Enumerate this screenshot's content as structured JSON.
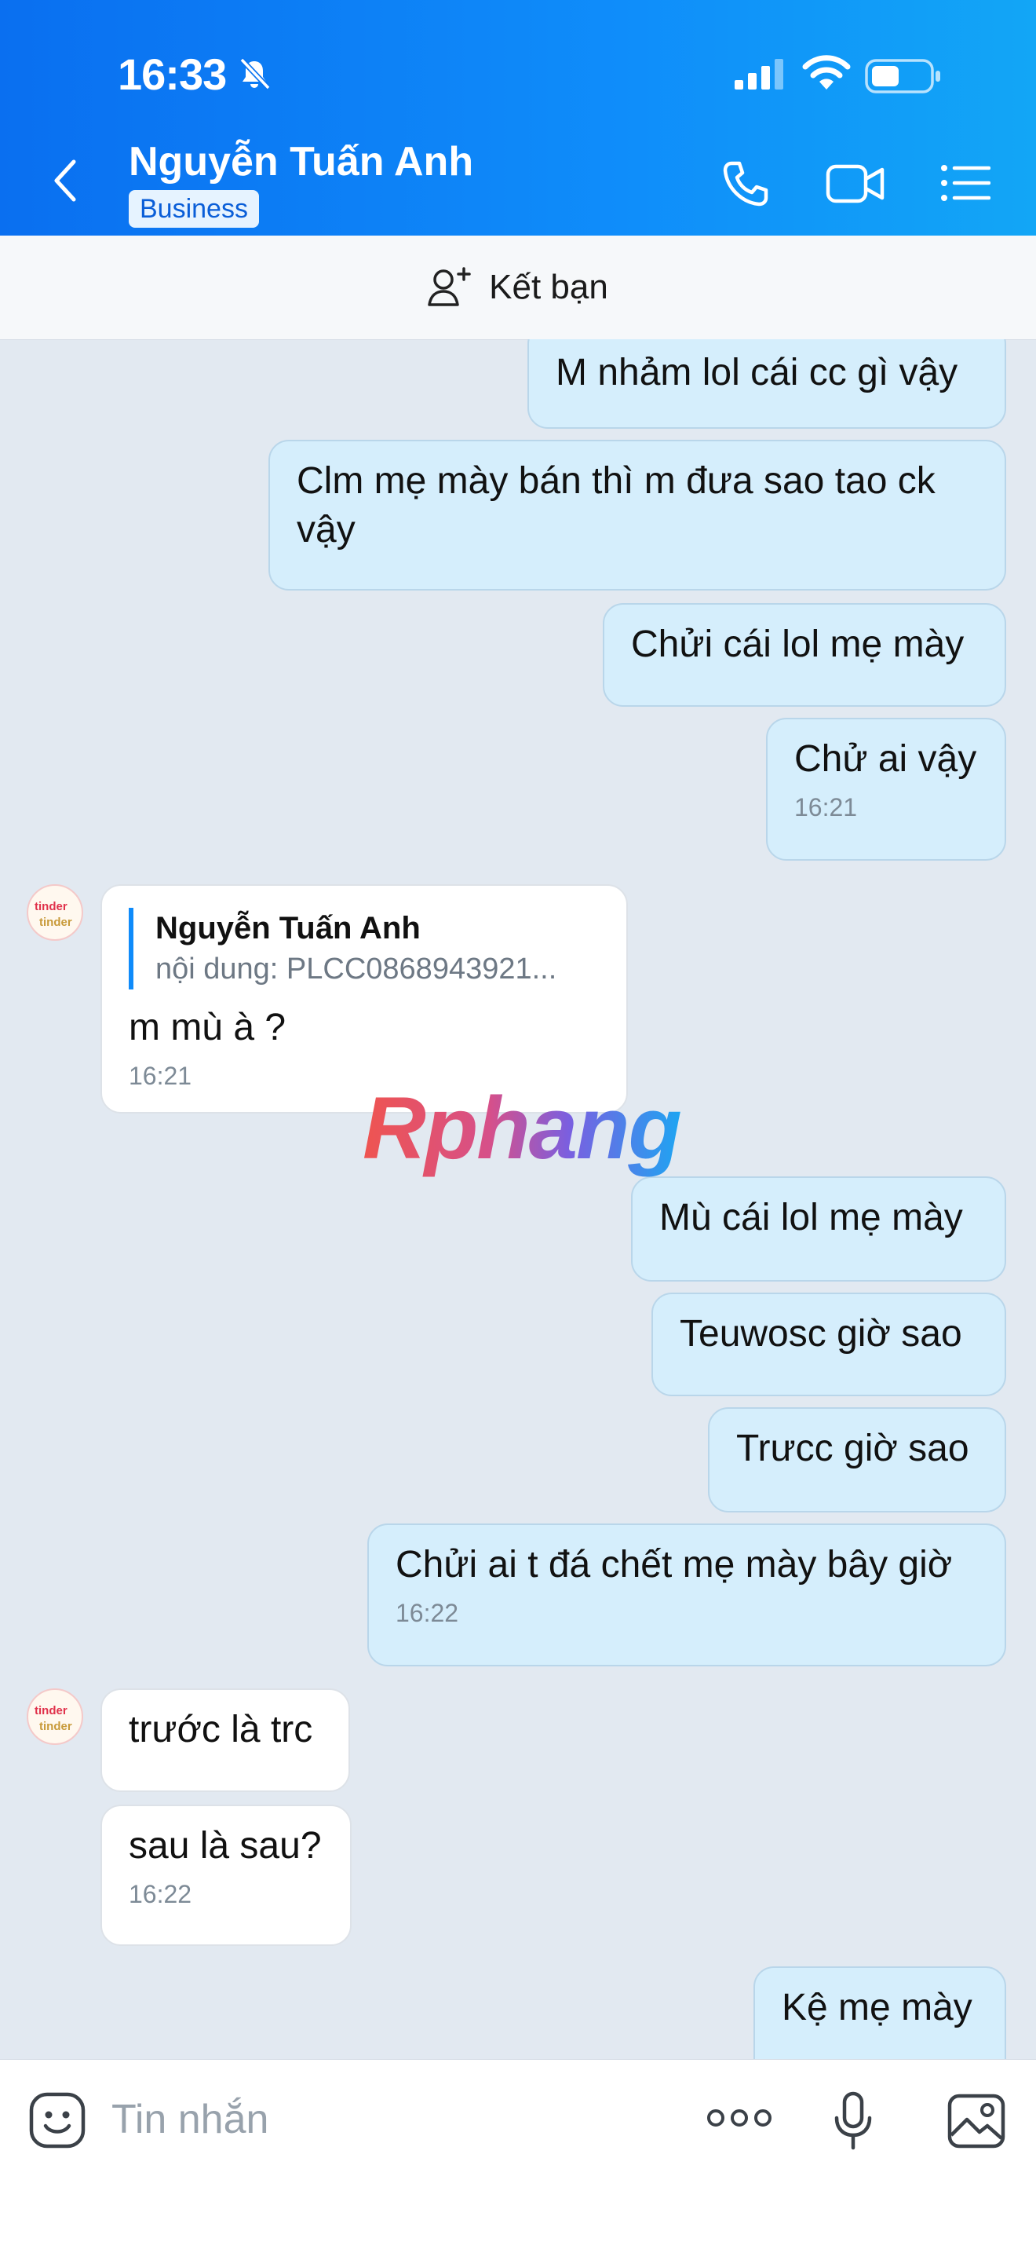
{
  "status_bar": {
    "time": "16:33"
  },
  "header": {
    "contact_name": "Nguyễn Tuấn Anh",
    "badge": "Business"
  },
  "add_friend": {
    "label": "Kết bạn"
  },
  "messages": [
    {
      "dir": "out",
      "text": "M nhảm lol cái cc gì vậy"
    },
    {
      "dir": "out",
      "text": "Clm mẹ mày bán thì m đưa sao tao ck vậy"
    },
    {
      "dir": "out",
      "text": "Chửi cái lol mẹ mày"
    },
    {
      "dir": "out",
      "text": "Chử ai vậy",
      "time": "16:21"
    },
    {
      "dir": "in",
      "quote_name": "Nguyễn Tuấn Anh",
      "quote_text": "nội dung: PLCC0868943921...",
      "text": "m mù à ?",
      "time": "16:21"
    },
    {
      "dir": "out",
      "text": "Mù cái lol mẹ mày"
    },
    {
      "dir": "out",
      "text": "Teuwosc giờ sao"
    },
    {
      "dir": "out",
      "text": "Trưcc giờ sao"
    },
    {
      "dir": "out",
      "text": "Chửi ai t đá chết mẹ mày bây giờ",
      "time": "16:22"
    },
    {
      "dir": "in",
      "text": "trước là trc"
    },
    {
      "dir": "in",
      "text": "sau là sau?",
      "time": "16:22"
    },
    {
      "dir": "out",
      "text": "Kệ mẹ mày"
    }
  ],
  "avatar_text": "tinder",
  "watermark": "Rphang",
  "composer": {
    "placeholder": "Tin nhắn"
  }
}
